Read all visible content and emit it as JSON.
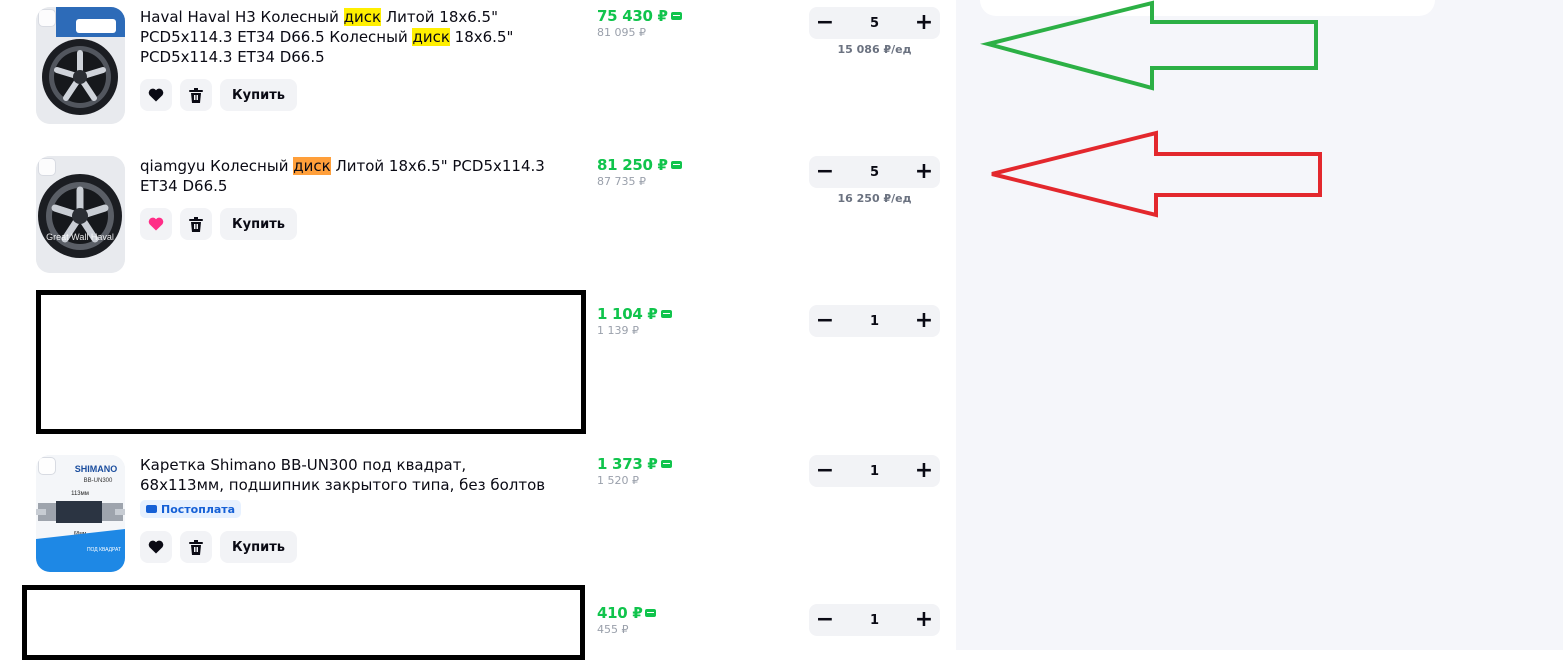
{
  "colors": {
    "price_green": "#10c44c",
    "highlight_yellow": "#ffef00",
    "highlight_orange": "#ff9f3a",
    "favorite_active": "#ff2d87",
    "arrow_green": "#2cb045",
    "arrow_red": "#e3282d",
    "badge_blue": "#1560d6"
  },
  "actions": {
    "buy_label": "Купить"
  },
  "items": [
    {
      "title_parts": [
        "Haval Haval H3 Колесный ",
        "диск",
        " Литой 18x6.5\" PCD5x114.3 ET34 D66.5 Колесный ",
        "диск",
        " 18x6.5\" PCD5x114.3 ET34 D66.5"
      ],
      "price": "75 430 ₽",
      "old_price": "81 095 ₽",
      "qty": "5",
      "unit_price": "15 086 ₽/ед",
      "favorite": false,
      "wallet_icon": "wallet-icon",
      "image_icon": "alloy-wheel-image"
    },
    {
      "title_parts": [
        "qiamgyu Колесный ",
        "диск",
        " Литой 18x6.5\" PCD5x114.3 ET34 D66.5"
      ],
      "image_text": "Great Wall Haval",
      "price": "81 250 ₽",
      "old_price": "87 735 ₽",
      "qty": "5",
      "unit_price": "16 250 ₽/ед",
      "favorite": true,
      "wallet_icon": "wallet-icon",
      "image_icon": "alloy-wheel-image"
    },
    {
      "price": "1 104 ₽",
      "old_price": "1 139 ₽",
      "qty": "1",
      "redacted": true
    },
    {
      "title": "Каретка Shimano BB-UN300 под квадрат, 68х113мм, подшипник закрытого типа, без болтов",
      "badge": "Постоплата",
      "image_texts": [
        "SHIMANO",
        "BB-UN300",
        "113мм",
        "68мм",
        "ПОД КВАДРАТ"
      ],
      "price": "1 373 ₽",
      "old_price": "1 520 ₽",
      "qty": "1",
      "favorite": false,
      "image_icon": "bottom-bracket-image"
    },
    {
      "price": "410 ₽",
      "old_price": "455 ₽",
      "qty": "1",
      "redacted": true
    }
  ],
  "qty_controls": {
    "minus": "−",
    "plus": "+"
  },
  "annotations": [
    {
      "name": "green-arrow",
      "color": "#2cb045",
      "points_to": "item-1"
    },
    {
      "name": "red-arrow",
      "color": "#e3282d",
      "points_to": "item-2"
    }
  ]
}
